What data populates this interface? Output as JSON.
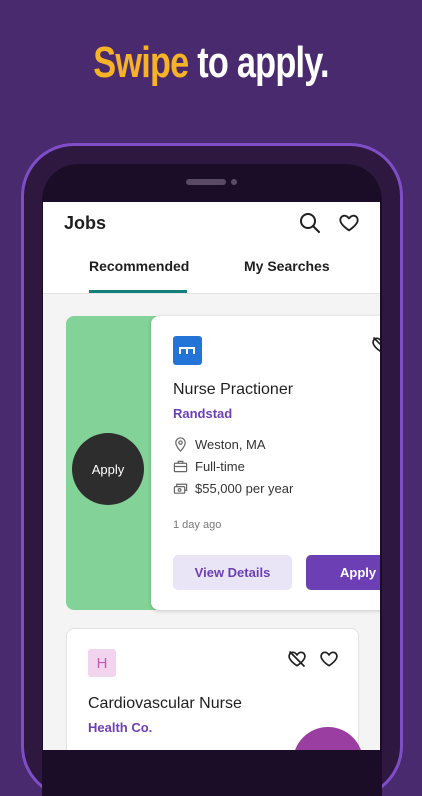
{
  "promo": {
    "headline_accent": "Swipe",
    "headline_rest": "to apply."
  },
  "colors": {
    "background": "#4a2a6e",
    "accent_yellow": "#f5b325",
    "brand_purple": "#6c3fb5",
    "tab_underline": "#12807a",
    "swipe_green": "#83d398"
  },
  "header": {
    "title": "Jobs",
    "icons": [
      "search-icon",
      "heart-icon"
    ]
  },
  "tabs": [
    {
      "label": "Recommended",
      "active": true
    },
    {
      "label": "My Searches",
      "active": false
    }
  ],
  "swipe_action": {
    "label": "Apply"
  },
  "jobs": [
    {
      "title": "Nurse Practioner",
      "company": "Randstad",
      "location": "Weston, MA",
      "type": "Full-time",
      "salary": "$55,000 per year",
      "posted": "1 day ago",
      "details_label": "View Details",
      "apply_label": "Apply",
      "logo_icon": "randstad-logo-icon"
    },
    {
      "title": "Cardiovascular Nurse",
      "company": "Health Co.",
      "logo_letter": "H"
    }
  ]
}
